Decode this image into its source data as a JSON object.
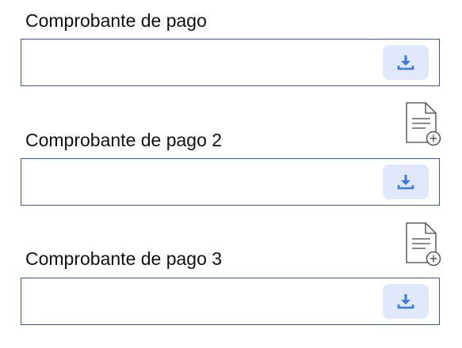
{
  "fields": [
    {
      "label": "Comprobante de pago"
    },
    {
      "label": "Comprobante de pago 2"
    },
    {
      "label": "Comprobante de pago 3"
    }
  ],
  "icons": {
    "upload": "download-icon",
    "add_file": "document-add-icon"
  },
  "colors": {
    "field_border": "#3a5a8c",
    "button_bg": "#dfe9fb",
    "icon_blue": "#3d77e0"
  }
}
